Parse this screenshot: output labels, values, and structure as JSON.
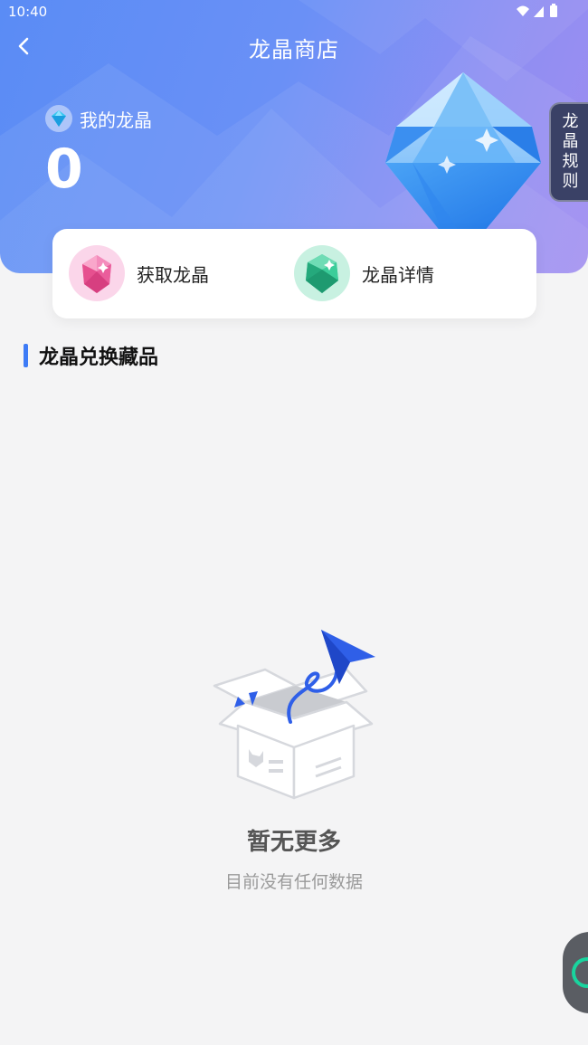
{
  "status_bar": {
    "time": "10:40"
  },
  "nav": {
    "title": "龙晶商店"
  },
  "balance": {
    "label": "我的龙晶",
    "value": "0"
  },
  "rules_tab": {
    "chars": [
      "龙",
      "晶",
      "规",
      "则"
    ]
  },
  "actions": [
    {
      "label": "获取龙晶",
      "icon": "pink-gem-icon"
    },
    {
      "label": "龙晶详情",
      "icon": "green-gem-icon"
    }
  ],
  "section": {
    "title": "龙晶兑换藏品"
  },
  "empty_state": {
    "title": "暂无更多",
    "subtitle": "目前没有任何数据"
  },
  "colors": {
    "accent": "#3d7bf6",
    "header_start": "#5a8cf5",
    "header_end": "#a08cf0",
    "rules_tab_bg": "#3a4166",
    "float_button_ring": "#19d49e"
  }
}
